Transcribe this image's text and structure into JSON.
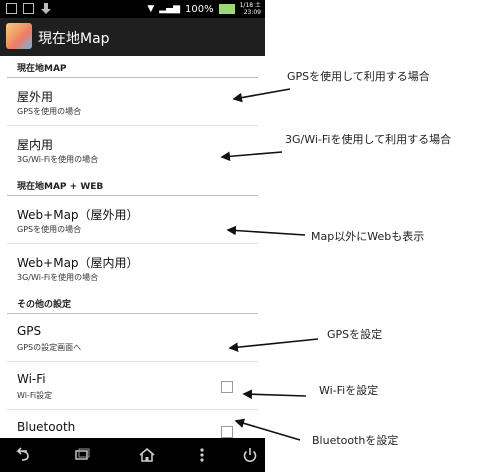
{
  "status_bar": {
    "battery_percent": "100%",
    "date": "1/18 土",
    "time": "23:09"
  },
  "action_bar": {
    "title": "現在地Map"
  },
  "sections": [
    {
      "header": "現在地MAP",
      "items": [
        {
          "title": "屋外用",
          "summary": "GPSを使用の場合"
        },
        {
          "title": "屋内用",
          "summary": "3G/Wi-Fiを使用の場合"
        }
      ]
    },
    {
      "header": "現在地MAP + WEB",
      "items": [
        {
          "title": "Web+Map（屋外用）",
          "summary": "GPSを使用の場合"
        },
        {
          "title": "Web+Map（屋内用）",
          "summary": "3G/Wi-Fiを使用の場合"
        }
      ]
    },
    {
      "header": "その他の設定",
      "items": [
        {
          "title": "GPS",
          "summary": "GPSの設定画面へ"
        },
        {
          "title": "Wi-Fi",
          "summary": "Wi-Fi設定",
          "checkbox": false
        },
        {
          "title": "Bluetooth",
          "summary": "",
          "checkbox": false
        }
      ]
    }
  ],
  "annotations": [
    "GPSを使用して利用する場合",
    "3G/Wi-Fiを使用して利用する場合",
    "Map以外にWebも表示",
    "GPSを設定",
    "Wi-Fiを設定",
    "Bluetoothを設定"
  ],
  "nav_bar": {
    "icons": [
      "back-icon",
      "recents-icon",
      "home-icon",
      "menu-icon",
      "power-icon"
    ]
  }
}
